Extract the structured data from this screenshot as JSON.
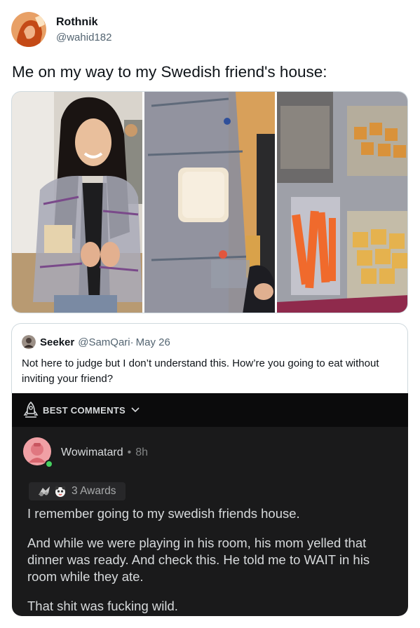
{
  "tweet": {
    "display_name": "Rothnik",
    "handle": "@wahid182",
    "text": "Me on my way to my Swedish friend's house:",
    "photos": [
      {
        "icon": "woman-wearing-ziploc-jacket-photo"
      },
      {
        "icon": "sandwich-bag-pocket-photo"
      },
      {
        "icon": "carrot-and-cracker-bags-photo"
      }
    ]
  },
  "quote": {
    "name": "Seeker",
    "handle": "@SamQari",
    "sep": "·",
    "date": "May 26",
    "text": "Not here to judge but I don’t understand this. How’re you going to eat without inviting your friend?"
  },
  "comments": {
    "sort_label": "BEST COMMENTS",
    "user": "Wowimatard",
    "dot": "•",
    "time": "8h",
    "awards": "3 Awards",
    "paragraphs": [
      "I remember going to my swedish friends house.",
      "And while we were playing in his room, his mom yelled that dinner was ready. And check this. He told me to WAIT in his room while they ate.",
      "That shit was fucking wild."
    ]
  },
  "colors": {
    "dark_bg": "#1a1a1b",
    "bar_bg": "#0b0b0c",
    "online": "#46d160",
    "muted": "#536471"
  }
}
